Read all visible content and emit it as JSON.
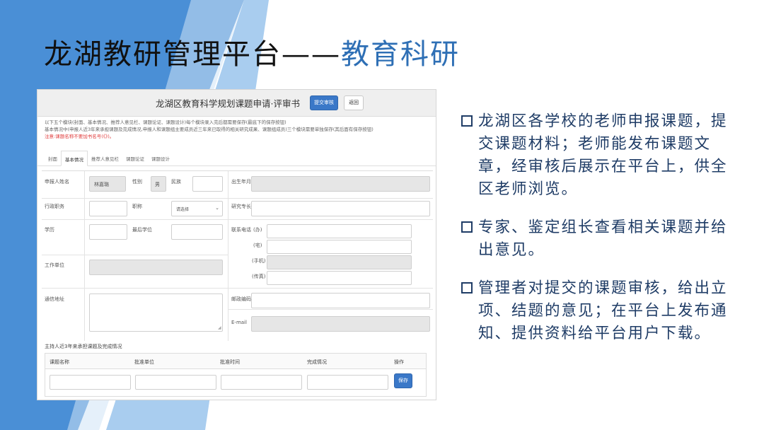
{
  "title": {
    "main": "龙湖教研管理平台",
    "dash": "——",
    "sub": "教育科研"
  },
  "screenshot": {
    "doc_title": "龙湖区教育科学规划课题申请·评审书",
    "submit_button": "提交审核",
    "back_button": "返回",
    "notice": [
      "以下五个模块(封面、基本情况、推荐人意见栏、课题论证、课题设计)每个模块录入完后都需要保存(最底下的保存按钮)",
      "基本情况中(申报人近3年来承担课题及完成情况,申报人和课题组主要成员近三年来已取得的相关研究成果、课题组成员)三个模块需要单独保存(其后面有保存按钮)"
    ],
    "warning": "注意:课题名称不要加书名号(《》)。",
    "tabs": [
      "封面",
      "基本情况",
      "推荐人意见栏",
      "课题论证",
      "课题设计"
    ],
    "active_tab": "基本情况",
    "form": {
      "applicant_label": "申报人姓名",
      "applicant_value": "林嘉璐",
      "gender_label": "性别",
      "gender_value": "男",
      "ethnicity_label": "民族",
      "birth_label": "出生年月",
      "position_label": "行政职务",
      "title_label": "职称",
      "title_select": "请选择",
      "specialty_label": "研究专长",
      "education_label": "学历",
      "degree_label": "最后学位",
      "phone_label": "联系电话",
      "phone_office": "(办)",
      "phone_home": "(宅)",
      "phone_mobile": "(手机)",
      "phone_fax": "(传真)",
      "workplace_label": "工作单位",
      "address_label": "通信地址",
      "postcode_label": "邮政编码",
      "email_label": "E-mail"
    },
    "history": {
      "title": "主持人近3年来承担课题及完成情况",
      "columns": [
        "课题名称",
        "批准单位",
        "批准时间",
        "完成情况",
        "操作"
      ],
      "save_button": "保存"
    }
  },
  "bullets": [
    "龙湖区各学校的老师申报课题，提交课题材料；老师能发布课题文章，经审核后展示在平台上，供全区老师浏览。",
    "专家、鉴定组长查看相关课题并给出意见。",
    "管理者对提交的课题审核，给出立项、结题的意见；在平台上发布通知、提供资料给平台用户下载。"
  ],
  "colors": {
    "accent_blue": "#2e6fb5",
    "bullet_text": "#1f3c66",
    "primary_button": "#3a78c8",
    "warning_red": "#e03c3c",
    "bg_blue_dark": "#4a8fd6",
    "bg_blue_light": "#a9cdef"
  }
}
